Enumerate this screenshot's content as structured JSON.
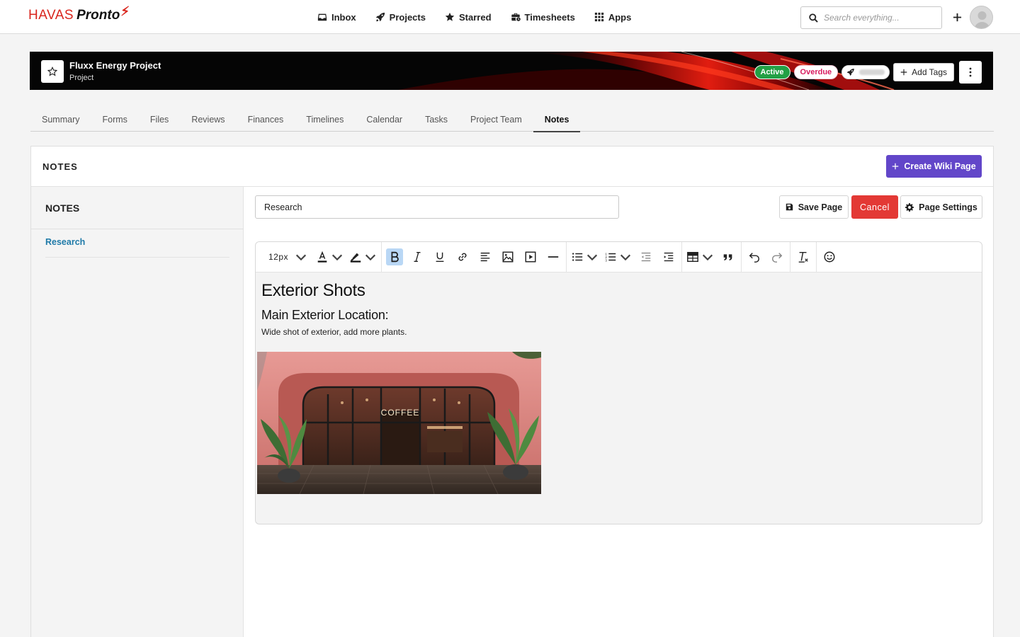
{
  "brand": {
    "havas": "HAVAS",
    "pronto": "Pronto"
  },
  "nav": {
    "items": [
      {
        "label": "Inbox",
        "icon": "inbox-icon"
      },
      {
        "label": "Projects",
        "icon": "rocket-icon"
      },
      {
        "label": "Starred",
        "icon": "star-icon"
      },
      {
        "label": "Timesheets",
        "icon": "business-time-icon"
      },
      {
        "label": "Apps",
        "icon": "grid-icon"
      }
    ],
    "search_placeholder": "Search everything..."
  },
  "project": {
    "title": "Fluxx Energy Project",
    "subtitle": "Project",
    "badges": {
      "active": "Active",
      "overdue": "Overdue"
    },
    "add_tags": "Add Tags"
  },
  "tabs": [
    "Summary",
    "Forms",
    "Files",
    "Reviews",
    "Finances",
    "Timelines",
    "Calendar",
    "Tasks",
    "Project Team",
    "Notes"
  ],
  "selected_tab": "Notes",
  "notes": {
    "panel_title": "NOTES",
    "create_wiki": "Create Wiki Page",
    "sidebar_title": "NOTES",
    "pages": [
      "Research"
    ],
    "page_title_value": "Research",
    "save": "Save Page",
    "cancel": "Cancel",
    "settings": "Page Settings"
  },
  "editor": {
    "font_size": "12px",
    "heading1": "Exterior Shots",
    "heading2": "Main Exterior Location:",
    "paragraph": "Wide shot of exterior, add more plants.",
    "image_sign": "COFFEE"
  },
  "colors": {
    "brand_red": "#d9251d",
    "active_green": "#22a045",
    "overdue_pink": "#d81b60",
    "wiki_purple": "#6246c9",
    "cancel_red": "#e33935",
    "link_blue": "#1f7aa8"
  }
}
